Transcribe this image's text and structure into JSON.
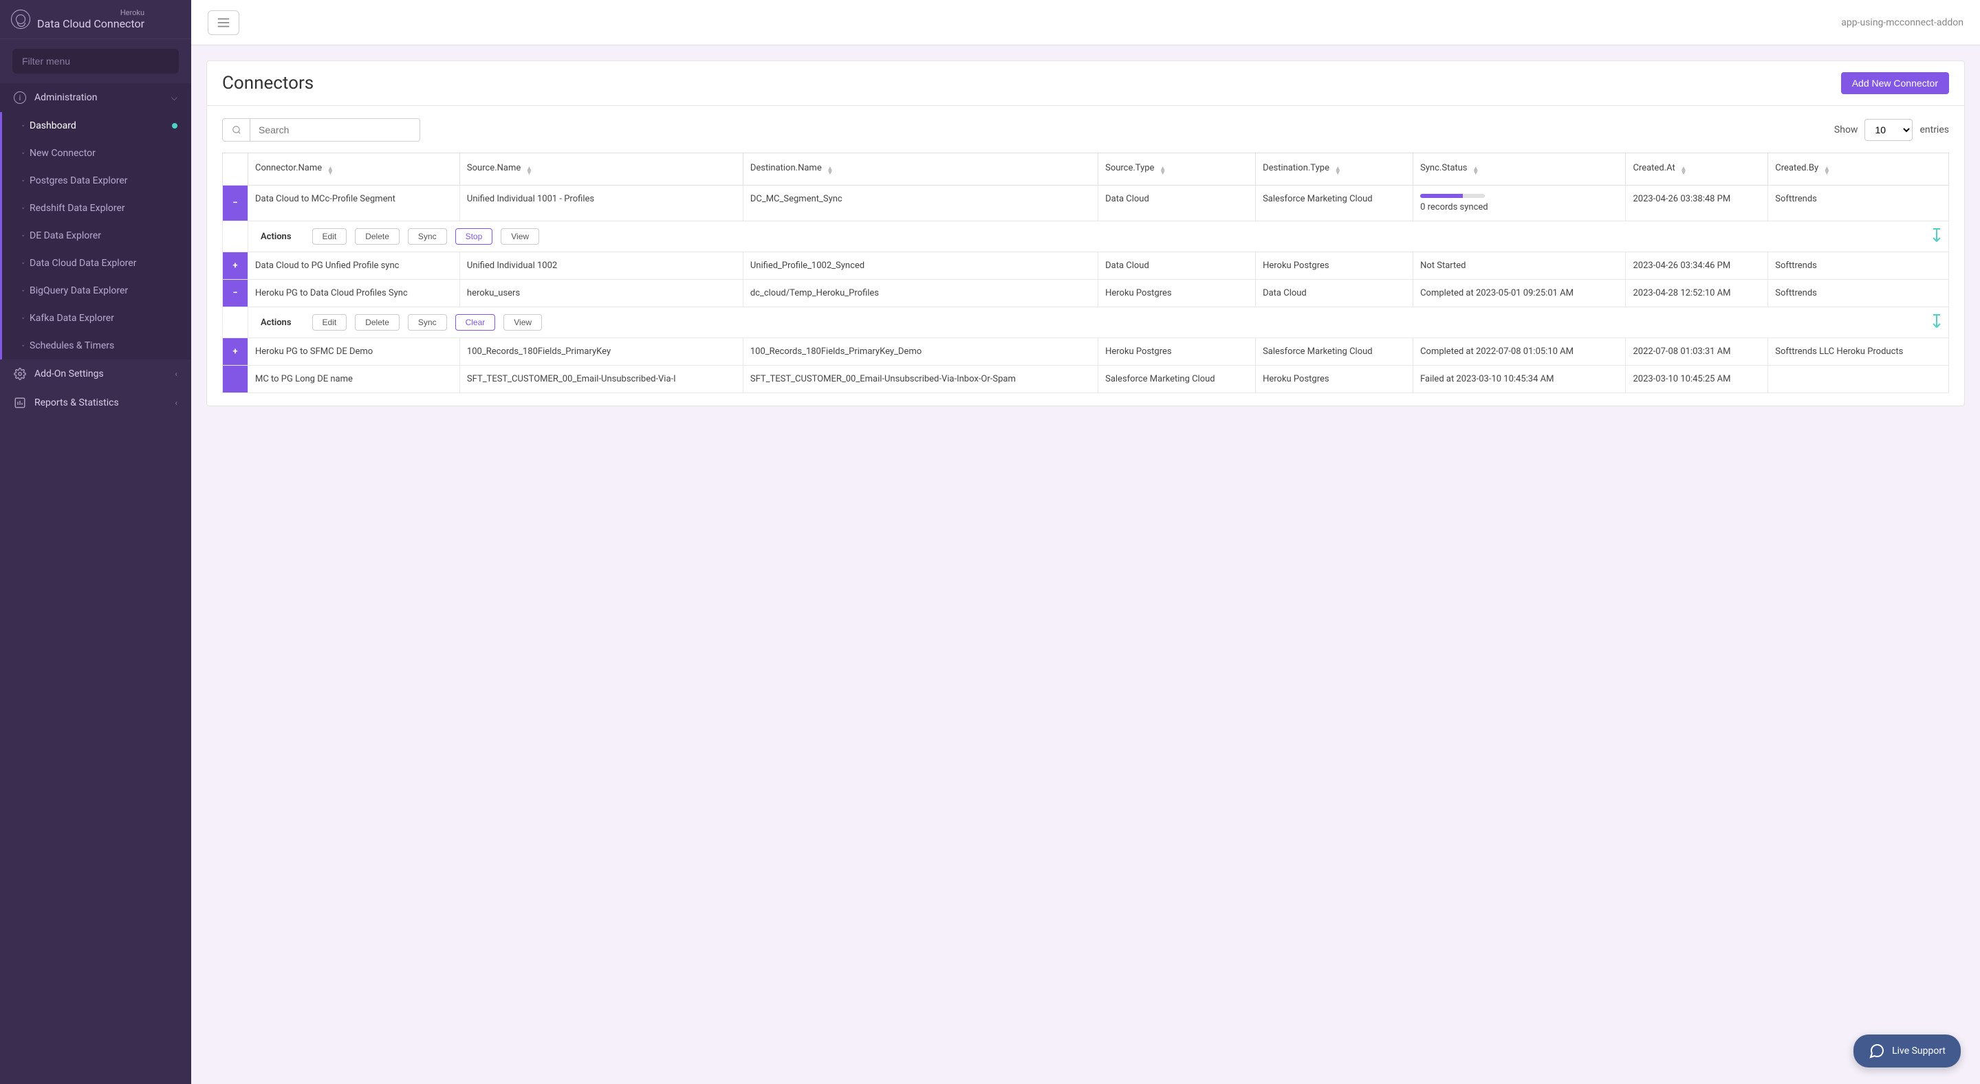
{
  "brand": {
    "super": "Heroku",
    "main": "Data Cloud Connector"
  },
  "sidebar": {
    "filter_placeholder": "Filter menu",
    "admin_label": "Administration",
    "items": [
      {
        "label": "Dashboard"
      },
      {
        "label": "New Connector"
      },
      {
        "label": "Postgres Data Explorer"
      },
      {
        "label": "Redshift Data Explorer"
      },
      {
        "label": "DE Data Explorer"
      },
      {
        "label": "Data Cloud Data Explorer"
      },
      {
        "label": "BigQuery Data Explorer"
      },
      {
        "label": "Kafka Data Explorer"
      },
      {
        "label": "Schedules & Timers"
      }
    ],
    "addon_label": "Add-On Settings",
    "reports_label": "Reports & Statistics"
  },
  "topbar": {
    "app_name": "app-using-mcconnect-addon"
  },
  "panel": {
    "title": "Connectors",
    "add_button": "Add New Connector",
    "search_placeholder": "Search",
    "show_label": "Show",
    "entries_label": "entries",
    "page_size": "10",
    "columns": [
      "Connector.Name",
      "Source.Name",
      "Destination.Name",
      "Source.Type",
      "Destination.Type",
      "Sync.Status",
      "Created.At",
      "Created.By"
    ],
    "actions_label": "Actions",
    "action_buttons_1": {
      "edit": "Edit",
      "delete": "Delete",
      "sync": "Sync",
      "stop": "Stop",
      "view": "View"
    },
    "action_buttons_2": {
      "edit": "Edit",
      "delete": "Delete",
      "sync": "Sync",
      "clear": "Clear",
      "view": "View"
    },
    "rows": [
      {
        "expander": "−",
        "connector": "Data Cloud to MCc-Profile Segment",
        "source": "Unified Individual 1001 - Profiles",
        "destination": "DC_MC_Segment_Sync",
        "source_type": "Data Cloud",
        "dest_type": "Salesforce Marketing Cloud",
        "status": "0 records synced",
        "created_at": "2023-04-26 03:38:48 PM",
        "created_by": "Softtrends"
      },
      {
        "expander": "+",
        "connector": "Data Cloud to PG Unfied Profile sync",
        "source": "Unified Individual 1002",
        "destination": "Unified_Profile_1002_Synced",
        "source_type": "Data Cloud",
        "dest_type": "Heroku Postgres",
        "status": "Not Started",
        "created_at": "2023-04-26 03:34:46 PM",
        "created_by": "Softtrends"
      },
      {
        "expander": "−",
        "connector": "Heroku PG to Data Cloud Profiles Sync",
        "source": "heroku_users",
        "destination": "dc_cloud/Temp_Heroku_Profiles",
        "source_type": "Heroku Postgres",
        "dest_type": "Data Cloud",
        "status": "Completed at 2023-05-01 09:25:01 AM",
        "created_at": "2023-04-28 12:52:10 AM",
        "created_by": "Softtrends"
      },
      {
        "expander": "+",
        "connector": "Heroku PG to SFMC DE Demo",
        "source": "100_Records_180Fields_PrimaryKey",
        "destination": "100_Records_180Fields_PrimaryKey_Demo",
        "source_type": "Heroku Postgres",
        "dest_type": "Salesforce Marketing Cloud",
        "status": "Completed at 2022-07-08 01:05:10 AM",
        "created_at": "2022-07-08 01:03:31 AM",
        "created_by": "Softtrends LLC Heroku Products"
      },
      {
        "expander": "",
        "connector": "MC to PG Long DE name",
        "source": "SFT_TEST_CUSTOMER_00_Email-Unsubscribed-Via-I",
        "destination": "SFT_TEST_CUSTOMER_00_Email-Unsubscribed-Via-Inbox-Or-Spam",
        "source_type": "Salesforce Marketing Cloud",
        "dest_type": "Heroku Postgres",
        "status": "Failed at 2023-03-10 10:45:34 AM",
        "created_at": "2023-03-10 10:45:25 AM",
        "created_by": ""
      }
    ]
  },
  "support": {
    "label": "Live Support"
  },
  "colors": {
    "accent": "#8257e6",
    "sidebar_bg": "#3b2d4f",
    "teal": "#4fd1c5",
    "support": "#435a8f"
  }
}
